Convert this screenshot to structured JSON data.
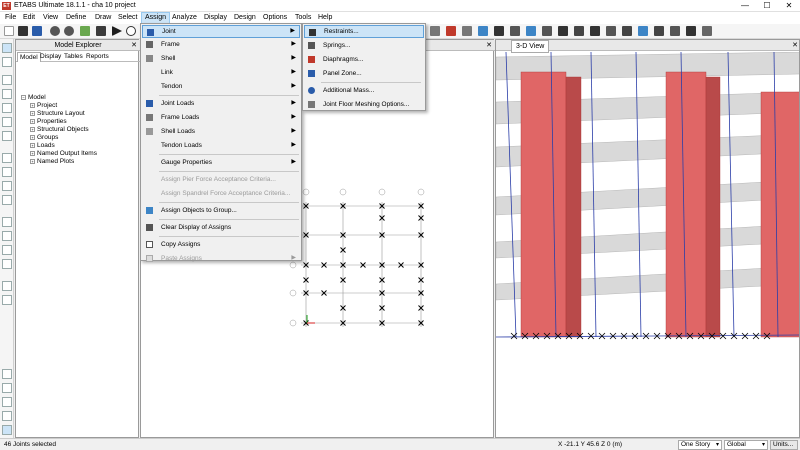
{
  "window": {
    "title": "ETABS Ultimate 18.1.1 - cha 10 project",
    "logo_text": "ET",
    "minimize": "—",
    "maximize": "☐",
    "close": "✕"
  },
  "menubar": [
    "File",
    "Edit",
    "View",
    "Define",
    "Draw",
    "Select",
    "Assign",
    "Analyze",
    "Display",
    "Design",
    "Options",
    "Tools",
    "Help"
  ],
  "explorer": {
    "title": "Model Explorer",
    "close": "✕",
    "tabs": [
      "Model",
      "Display",
      "Tables",
      "Reports"
    ],
    "root": "Model",
    "items": [
      "Project",
      "Structure Layout",
      "Properties",
      "Structural Objects",
      "Groups",
      "Loads",
      "Named Output Items",
      "Named Plots"
    ]
  },
  "views": {
    "plan_close": "✕",
    "view3d_close": "✕",
    "view3d_title": "3-D View"
  },
  "assign_menu": {
    "items": [
      {
        "label": "Joint",
        "submenu": true,
        "highlight": true
      },
      {
        "label": "Frame",
        "submenu": true
      },
      {
        "label": "Shell",
        "submenu": true
      },
      {
        "label": "Link",
        "submenu": true
      },
      {
        "label": "Tendon",
        "submenu": true
      },
      {
        "label": "Joint Loads",
        "submenu": true
      },
      {
        "label": "Frame Loads",
        "submenu": true
      },
      {
        "label": "Shell Loads",
        "submenu": true
      },
      {
        "label": "Tendon Loads",
        "submenu": true
      },
      {
        "label": "Gauge Properties",
        "submenu": true
      },
      {
        "label": "Assign Pier Force Acceptance Criteria...",
        "disabled": true
      },
      {
        "label": "Assign Spandrel Force Acceptance Criteria...",
        "disabled": true
      },
      {
        "label": "Assign Objects to Group..."
      },
      {
        "label": "Clear Display of Assigns"
      },
      {
        "label": "Copy Assigns"
      },
      {
        "label": "Paste Assigns",
        "submenu": true,
        "disabled": true
      }
    ]
  },
  "joint_submenu": {
    "items": [
      {
        "label": "Restraints...",
        "highlight": true
      },
      {
        "label": "Springs..."
      },
      {
        "label": "Diaphragms..."
      },
      {
        "label": "Panel Zone..."
      },
      {
        "label": "Additional Mass..."
      },
      {
        "label": "Joint Floor Meshing Options..."
      }
    ]
  },
  "status": {
    "selection": "46 Joints selected",
    "coords": "X -21.1  Y 45.6  Z 0 (m)",
    "story": "One Story",
    "coord_system": "Global",
    "units": "Units..."
  },
  "colors": {
    "highlight": "#cce4f7",
    "shear_wall": "#e06666",
    "slab": "#d9d9d9",
    "grid_line": "#2b3ea8"
  }
}
